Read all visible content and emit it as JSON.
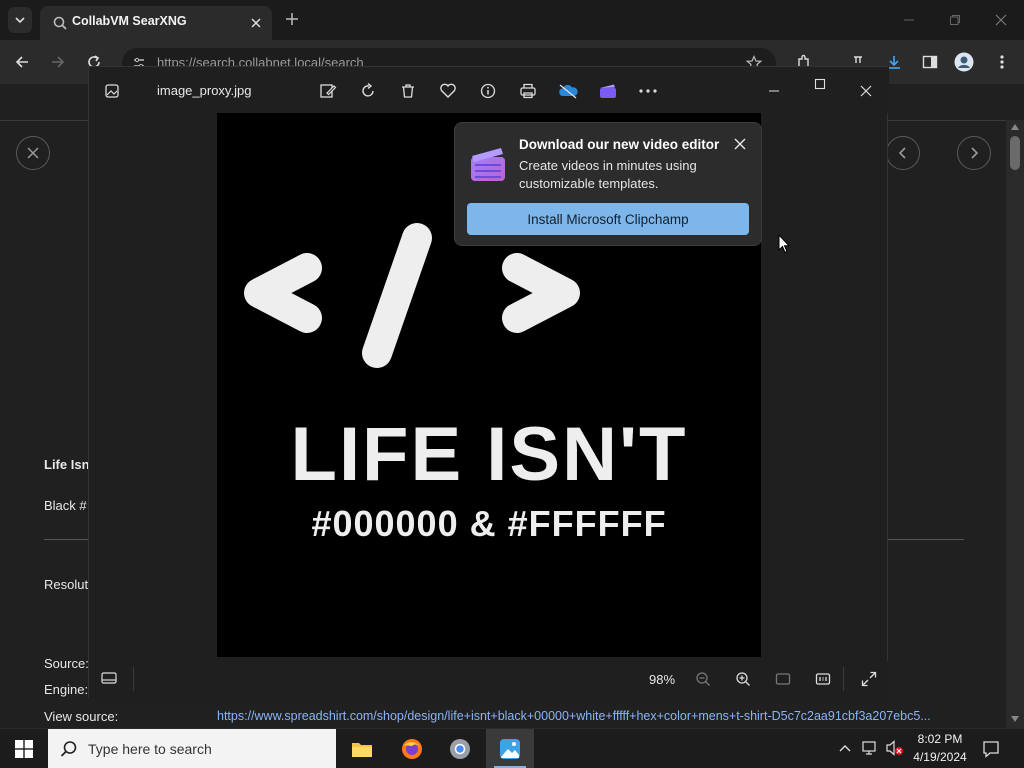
{
  "browser": {
    "tab_title": "CollabVM SearXNG",
    "address": "https://search.collabnet.local/search"
  },
  "page": {
    "result_title": "Life Isn",
    "result_desc": "Black #",
    "label_resolution": "Resolut",
    "label_source": "Source:",
    "label_engine": "Engine:",
    "label_view_source": "View source:",
    "view_source_url": "https://www.spreadshirt.com/shop/design/life+isnt+black+00000+white+fffff+hex+color+mens+t-shirt-D5c7c2aa91cbf3a207ebc5..."
  },
  "viewer": {
    "filename": "image_proxy.jpg",
    "zoom": "98%",
    "image_text_line1": "LIFE ISN'T",
    "image_text_line2": "#000000 & #FFFFFF"
  },
  "popup": {
    "title": "Download our new video editor",
    "body": "Create videos in minutes using customizable templates.",
    "button": "Install Microsoft Clipchamp"
  },
  "taskbar": {
    "search_placeholder": "Type here to search",
    "time": "8:02 PM",
    "date": "4/19/2024"
  },
  "colors": {
    "accent": "#7cb6ea",
    "link": "#8ab4f8",
    "window_bg": "#1f1f1f"
  }
}
